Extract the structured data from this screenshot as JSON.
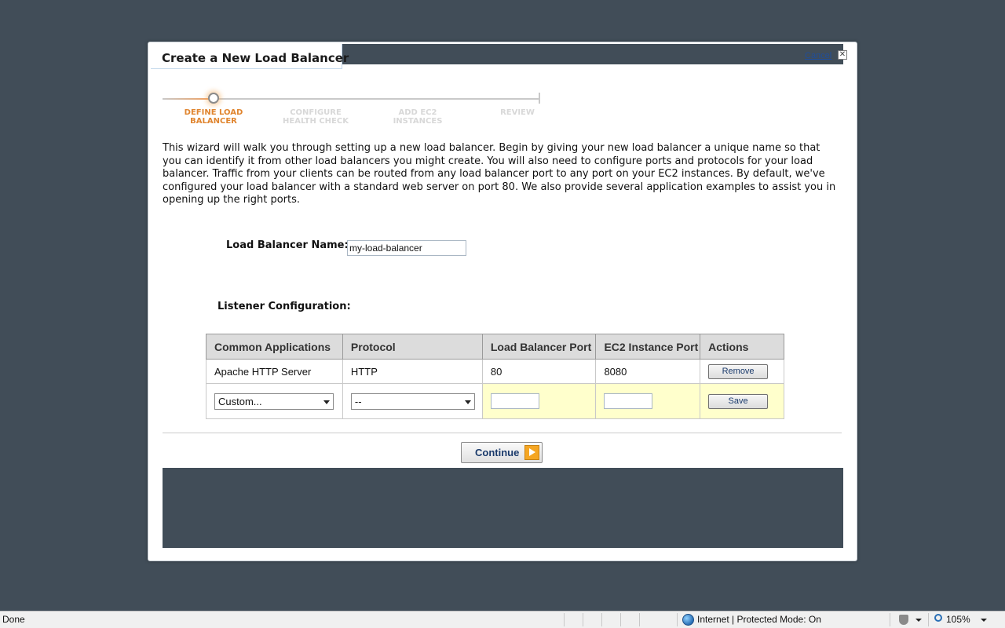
{
  "dialog": {
    "title": "Create a New Load Balancer",
    "cancel_label": "Cancel",
    "close_glyph": "✕"
  },
  "wizard": {
    "steps": [
      {
        "line1": "DEFINE LOAD",
        "line2": "BALANCER",
        "active": true
      },
      {
        "line1": "CONFIGURE",
        "line2": "HEALTH CHECK",
        "active": false
      },
      {
        "line1": "ADD EC2",
        "line2": "INSTANCES",
        "active": false
      },
      {
        "line1": "REVIEW",
        "line2": "",
        "active": false
      }
    ],
    "active_color": "#e0852f"
  },
  "intro_text": "This wizard will walk you through setting up a new load balancer. Begin by giving your new load balancer a unique name so that you can identify it from other load balancers you might create. You will also need to configure ports and protocols for your load balancer. Traffic from your clients can be routed from any load balancer port to any port on your EC2 instances. By default, we've configured your load balancer with a standard web server on port 80. We also provide several application examples to assist you in opening up the right ports.",
  "form": {
    "name_label": "Load Balancer Name:",
    "name_value": "my-load-balancer",
    "listener_label": "Listener Configuration:"
  },
  "listener_table": {
    "headers": [
      "Common Applications",
      "Protocol",
      "Load Balancer Port",
      "EC2 Instance Port",
      "Actions"
    ],
    "rows": [
      {
        "application": "Apache HTTP Server",
        "protocol": "HTTP",
        "lb_port": "80",
        "instance_port": "8080",
        "action": "Remove"
      }
    ],
    "new_row": {
      "application_selected": "Custom...",
      "protocol_selected": "--",
      "lb_port": "",
      "instance_port": "",
      "action": "Save"
    }
  },
  "continue_label": "Continue",
  "statusbar": {
    "status": "Done",
    "zone": "Internet | Protected Mode: On",
    "zoom": "105%"
  },
  "colors": {
    "backdrop": "#414d58",
    "edit_row_highlight": "#ffffcc",
    "link": "#1f4e9c",
    "continue_arrow": "#f5a623"
  }
}
